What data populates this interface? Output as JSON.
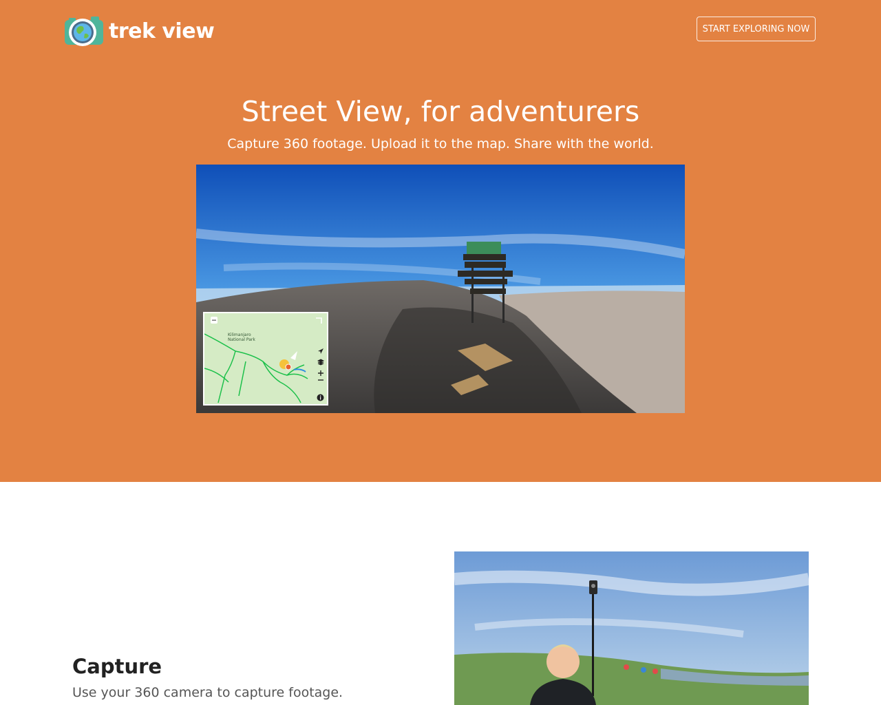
{
  "brand": {
    "name": "trek view"
  },
  "header": {
    "cta_label": "START EXPLORING NOW"
  },
  "hero": {
    "title": "Street View, for adventurers",
    "subtitle": "Capture 360 footage. Upload it to the map. Share with the world.",
    "map_label": "Kilimanjaro National Park"
  },
  "capture": {
    "title": "Capture",
    "text": "Use your 360 camera to capture footage."
  },
  "colors": {
    "hero_bg": "#e38242",
    "map_route": "#1cc04a"
  },
  "icons": [
    "camera-globe-logo",
    "navigation-arrow-icon",
    "layers-icon",
    "zoom-in-icon",
    "zoom-out-icon",
    "info-icon",
    "expand-icon",
    "collapse-icon"
  ]
}
